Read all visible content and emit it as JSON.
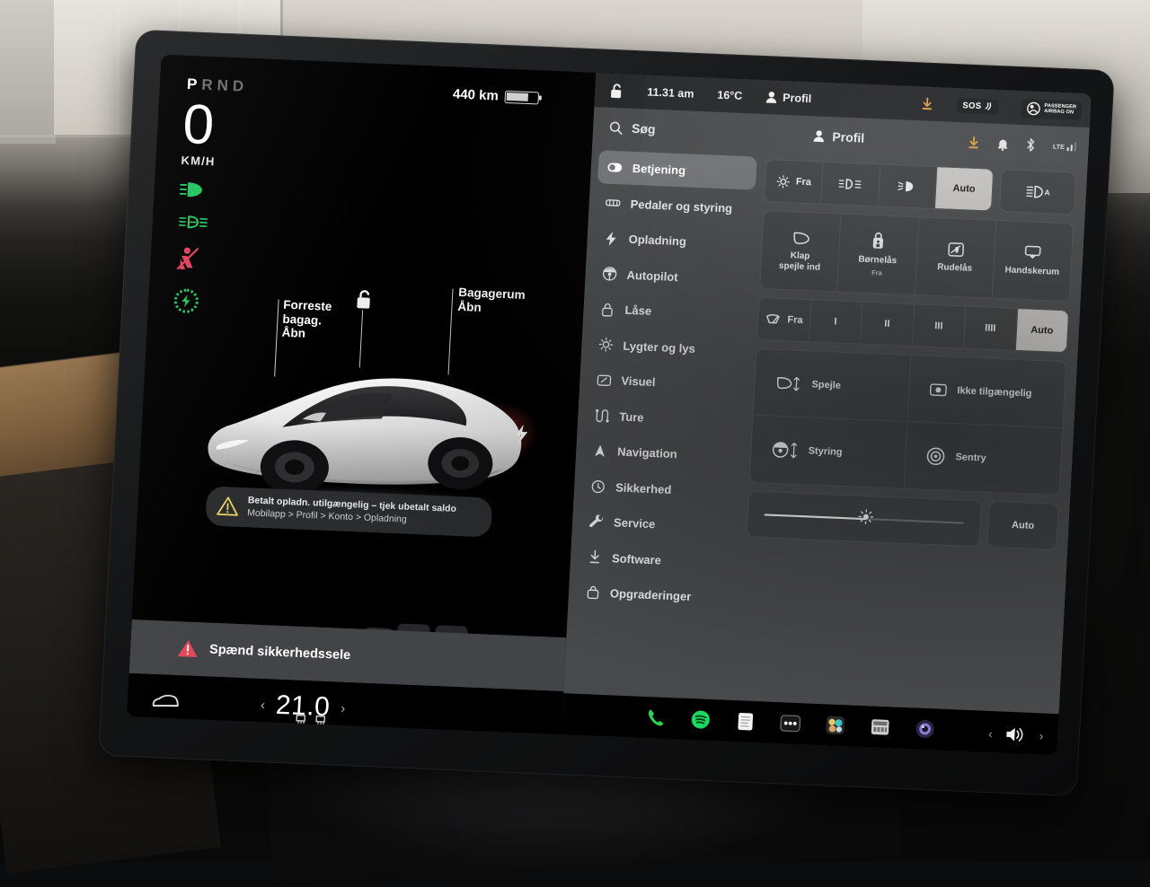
{
  "driving": {
    "gear_indicator": "PRND",
    "gear_active": "P",
    "speed": "0",
    "speed_unit": "KM/H",
    "range": "440 km",
    "telltales": [
      {
        "name": "low-beam-headlight-icon",
        "color": "#22c55e"
      },
      {
        "name": "fog-light-icon",
        "color": "#22c55e"
      },
      {
        "name": "seatbelt-warning-icon",
        "color": "#e0405a"
      },
      {
        "name": "ready-to-drive-icon",
        "color": "#22c55e"
      }
    ],
    "callout_front_trunk": "Forreste\nbagag.\nÅbn",
    "callout_front_trunk_l1": "Forreste",
    "callout_front_trunk_l2": "bagag.",
    "callout_front_trunk_l3": "Åbn",
    "callout_trunk_l1": "Bagagerum",
    "callout_trunk_l2": "Åbn",
    "charge_alert_line1": "Betalt opladn. utilgængelig – tjek ubetalt saldo",
    "charge_alert_line2": "Mobilapp > Profil > Konto > Opladning",
    "seatbelt_warning": "Spænd sikkerhedssele",
    "temperature": "21.0"
  },
  "statusbar": {
    "time": "11.31 am",
    "outside_temp": "16°C",
    "profile": "Profil",
    "sos_label": "SOS",
    "airbag_line1": "PASSENGER",
    "airbag_line2": "AIRBAG ON"
  },
  "header": {
    "search_placeholder": "Søg",
    "profile_label": "Profil"
  },
  "sidebar": {
    "items": [
      {
        "label": "Betjening",
        "icon": "toggle-icon",
        "active": true
      },
      {
        "label": "Pedaler og styring",
        "icon": "pedals-icon",
        "active": false
      },
      {
        "label": "Opladning",
        "icon": "bolt-icon",
        "active": false
      },
      {
        "label": "Autopilot",
        "icon": "steering-wheel-icon",
        "active": false
      },
      {
        "label": "Låse",
        "icon": "lock-icon",
        "active": false
      },
      {
        "label": "Lygter og lys",
        "icon": "sun-icon",
        "active": false
      },
      {
        "label": "Visuel",
        "icon": "display-icon",
        "active": false
      },
      {
        "label": "Ture",
        "icon": "trips-icon",
        "active": false
      },
      {
        "label": "Navigation",
        "icon": "navigation-arrow-icon",
        "active": false
      },
      {
        "label": "Sikkerhed",
        "icon": "shield-clock-icon",
        "active": false
      },
      {
        "label": "Service",
        "icon": "wrench-icon",
        "active": false
      },
      {
        "label": "Software",
        "icon": "download-icon",
        "active": false
      },
      {
        "label": "Opgraderinger",
        "icon": "upgrade-bag-icon",
        "active": false
      }
    ]
  },
  "controls": {
    "lights": {
      "options": [
        {
          "label": "Fra",
          "icon": "lights-off-icon",
          "selected": false
        },
        {
          "label": "",
          "icon": "parking-lights-icon",
          "selected": false
        },
        {
          "label": "",
          "icon": "low-beam-icon",
          "selected": false
        },
        {
          "label": "Auto",
          "icon": "",
          "selected": true
        }
      ],
      "auto_high_beam": {
        "label": "",
        "icon": "auto-high-beam-icon",
        "selected": false
      }
    },
    "tiles": [
      {
        "label": "Klap\nspejle ind",
        "line1": "Klap",
        "line2": "spejle ind",
        "sub": "",
        "icon": "mirror-fold-icon"
      },
      {
        "label": "Børnelås",
        "line1": "Børnelås",
        "line2": "",
        "sub": "Fra",
        "icon": "child-lock-icon"
      },
      {
        "label": "Rudelås",
        "line1": "Rudelås",
        "line2": "",
        "sub": "",
        "icon": "window-lock-icon"
      },
      {
        "label": "Handskerum",
        "line1": "Handskerum",
        "line2": "",
        "sub": "",
        "icon": "glovebox-icon"
      }
    ],
    "wipers": {
      "options": [
        {
          "label": "Fra",
          "icon": "wiper-icon",
          "selected": false
        },
        {
          "label": "I",
          "icon": "",
          "selected": false
        },
        {
          "label": "II",
          "icon": "",
          "selected": false
        },
        {
          "label": "III",
          "icon": "",
          "selected": false
        },
        {
          "label": "IIII",
          "icon": "",
          "selected": false
        },
        {
          "label": "Auto",
          "icon": "",
          "selected": true
        }
      ]
    },
    "quad": [
      {
        "label": "Spejle",
        "icon": "mirror-adjust-icon"
      },
      {
        "label": "Ikke tilgængelig",
        "icon": "camera-icon"
      },
      {
        "label": "Styring",
        "icon": "steering-adjust-icon"
      },
      {
        "label": "Sentry",
        "icon": "sentry-mode-icon"
      }
    ],
    "brightness": {
      "value": 51,
      "icon": "brightness-icon",
      "auto_label": "Auto"
    }
  },
  "dock": {
    "apps": [
      {
        "name": "phone-icon",
        "color": "#2fd24f"
      },
      {
        "name": "spotify-icon",
        "color": "#1ed760"
      },
      {
        "name": "notes-icon",
        "color": "#f2f2f2"
      },
      {
        "name": "more-dots-icon",
        "color": "#ffffff"
      },
      {
        "name": "apps-icon",
        "color": "#f0c14b"
      },
      {
        "name": "media-icon",
        "color": "#cfcfcf"
      },
      {
        "name": "camera-icon",
        "color": "#8e7bd6"
      }
    ],
    "volume_icon": "volume-icon"
  }
}
